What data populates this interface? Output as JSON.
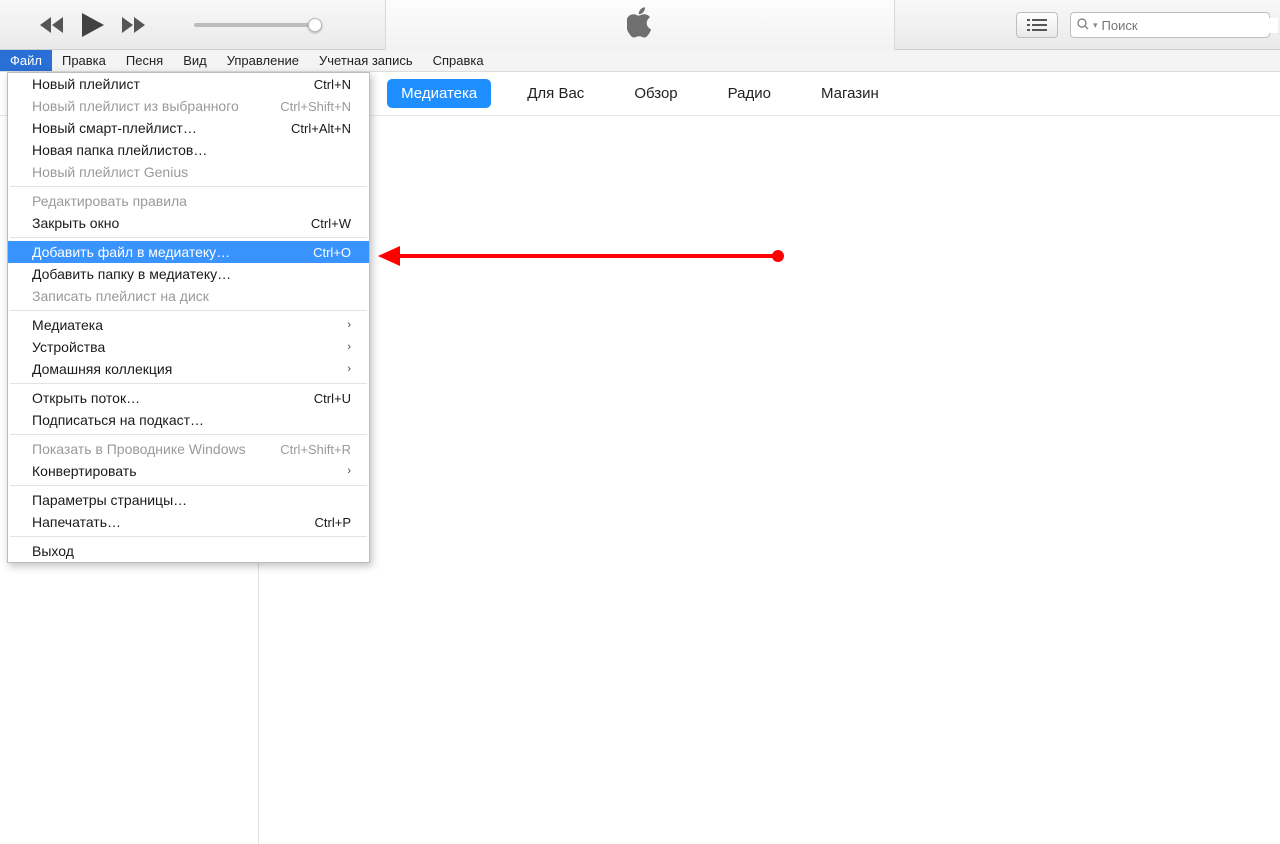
{
  "search": {
    "placeholder": "Поиск"
  },
  "menubar": {
    "items": [
      "Файл",
      "Правка",
      "Песня",
      "Вид",
      "Управление",
      "Учетная запись",
      "Справка"
    ],
    "active_index": 0
  },
  "tabs": {
    "items": [
      "Медиатека",
      "Для Вас",
      "Обзор",
      "Радио",
      "Магазин"
    ],
    "active_index": 0
  },
  "file_menu": {
    "groups": [
      [
        {
          "label": "Новый плейлист",
          "shortcut": "Ctrl+N",
          "enabled": true
        },
        {
          "label": "Новый плейлист из выбранного",
          "shortcut": "Ctrl+Shift+N",
          "enabled": false
        },
        {
          "label": "Новый смарт-плейлист…",
          "shortcut": "Ctrl+Alt+N",
          "enabled": true
        },
        {
          "label": "Новая папка плейлистов…",
          "shortcut": "",
          "enabled": true
        },
        {
          "label": "Новый плейлист Genius",
          "shortcut": "",
          "enabled": false
        }
      ],
      [
        {
          "label": "Редактировать правила",
          "shortcut": "",
          "enabled": false
        },
        {
          "label": "Закрыть окно",
          "shortcut": "Ctrl+W",
          "enabled": true
        }
      ],
      [
        {
          "label": "Добавить файл в медиатеку…",
          "shortcut": "Ctrl+O",
          "enabled": true,
          "highlight": true
        },
        {
          "label": "Добавить папку в медиатеку…",
          "shortcut": "",
          "enabled": true
        },
        {
          "label": "Записать плейлист на диск",
          "shortcut": "",
          "enabled": false
        }
      ],
      [
        {
          "label": "Медиатека",
          "shortcut": "",
          "enabled": true,
          "submenu": true
        },
        {
          "label": "Устройства",
          "shortcut": "",
          "enabled": true,
          "submenu": true
        },
        {
          "label": "Домашняя коллекция",
          "shortcut": "",
          "enabled": true,
          "submenu": true
        }
      ],
      [
        {
          "label": "Открыть поток…",
          "shortcut": "Ctrl+U",
          "enabled": true
        },
        {
          "label": "Подписаться на подкаст…",
          "shortcut": "",
          "enabled": true
        }
      ],
      [
        {
          "label": "Показать в Проводнике Windows",
          "shortcut": "Ctrl+Shift+R",
          "enabled": false
        },
        {
          "label": "Конвертировать",
          "shortcut": "",
          "enabled": true,
          "submenu": true
        }
      ],
      [
        {
          "label": "Параметры страницы…",
          "shortcut": "",
          "enabled": true
        },
        {
          "label": "Напечатать…",
          "shortcut": "Ctrl+P",
          "enabled": true
        }
      ],
      [
        {
          "label": "Выход",
          "shortcut": "",
          "enabled": true
        }
      ]
    ]
  }
}
